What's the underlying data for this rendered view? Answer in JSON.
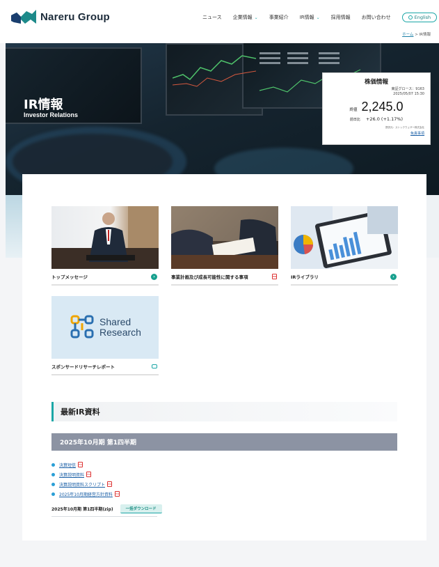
{
  "header": {
    "logo_text": "Nareru Group",
    "nav": [
      {
        "label": "ニュース",
        "has_dropdown": false
      },
      {
        "label": "企業情報",
        "has_dropdown": true
      },
      {
        "label": "事業紹介",
        "has_dropdown": false
      },
      {
        "label": "IR情報",
        "has_dropdown": true
      },
      {
        "label": "採用情報",
        "has_dropdown": false
      },
      {
        "label": "お問い合わせ",
        "has_dropdown": false
      }
    ],
    "lang_button": "English",
    "breadcrumb": {
      "home": "ホーム",
      "separator": ">",
      "current": "IR情報"
    }
  },
  "hero": {
    "title": "IR情報",
    "subtitle": "Investor Relations"
  },
  "stock": {
    "title": "株価情報",
    "market": "東証グロース：9163",
    "datetime": "2025/05/07 15:30",
    "price_label": "終値",
    "price": "2,245.0",
    "change_label": "前日比",
    "change": "+26.0 (+1.17%)",
    "note": "提供元：ストックウェザー株式会社",
    "disclaimer_link": "免責事項"
  },
  "cards": [
    {
      "label": "トップメッセージ",
      "icon": "arrow-right-icon"
    },
    {
      "label": "事業計画及び成長可能性に関する事項",
      "icon": "pdf-icon"
    },
    {
      "label": "IRライブラリ",
      "icon": "arrow-right-icon"
    },
    {
      "label": "スポンサードリサーチレポート",
      "icon": "external-link-icon"
    }
  ],
  "shared_research": {
    "line1": "Shared",
    "line2": "Research"
  },
  "latest": {
    "heading": "最新IR資料",
    "period": "2025年10月期 第1四半期",
    "docs": [
      "決算短信",
      "決算説明資料",
      "決算説明資料スクリプト",
      "2025年10月期経営方針資料"
    ],
    "zip_label": "2025年10月期 第1四半期(zip)",
    "zip_button": "一括ダウンロード"
  },
  "colors": {
    "accent": "#1aa6a6",
    "period_bar": "#8c93a3",
    "link": "#1a5fa6"
  }
}
